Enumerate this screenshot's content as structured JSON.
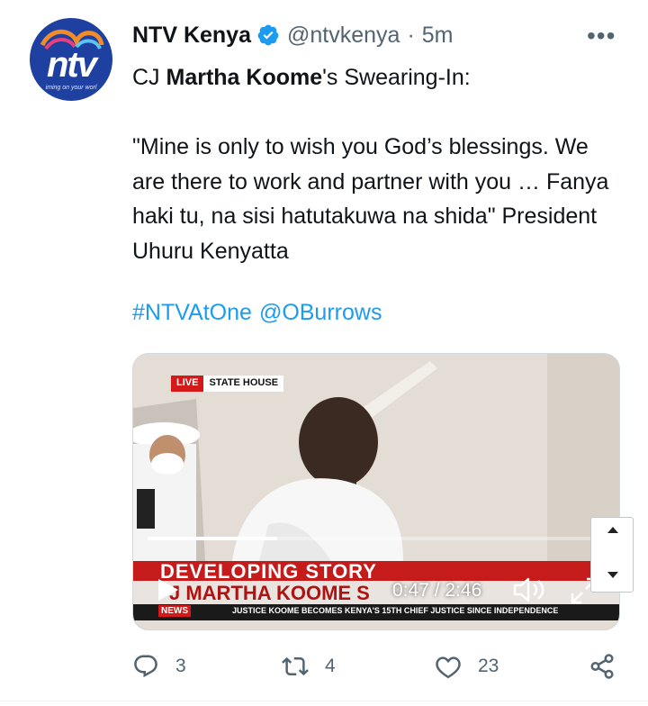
{
  "author": {
    "name": "NTV Kenya",
    "handle": "@ntvkenya",
    "separator": "·",
    "time": "5m",
    "avatar_wordmark": "ntv",
    "avatar_tagline": "iming on your worl"
  },
  "tweet": {
    "line1_prefix": "CJ ",
    "line1_bold": "Martha Koome",
    "line1_suffix": "'s Swearing-In:",
    "quote": "\"Mine is only to wish you God’s blessings. We are there to work and partner with you … Fanya haki tu, na sisi hatutakuwa na shida\" President Uhuru Kenyatta",
    "hashtag": "#NTVAtOne",
    "mention": "@OBurrows"
  },
  "video": {
    "live_label": "LIVE",
    "location_label": "STATE HOUSE",
    "banner_top": "DEVELOPING STORY",
    "banner_name": "J MARTHA KOOME S",
    "ticker_brand": "NEWS",
    "ticker_text": "JUSTICE KOOME BECOMES KENYA'S 15TH CHIEF JUSTICE SINCE INDEPENDENCE",
    "current_time": "0:47",
    "duration": "2:46",
    "time_separator": " / ",
    "progress_fraction": 0.283
  },
  "actions": {
    "replies": "3",
    "retweets": "4",
    "likes": "23"
  },
  "colors": {
    "accent": "#1d9bf0",
    "muted": "#536471",
    "text": "#0f1419",
    "news_red": "#c61b1b"
  },
  "icons": [
    "verified-badge-icon",
    "more-options-icon",
    "play-icon",
    "volume-icon",
    "fullscreen-icon",
    "reply-icon",
    "retweet-icon",
    "like-icon",
    "share-icon",
    "scroll-up-icon",
    "scroll-down-icon"
  ]
}
